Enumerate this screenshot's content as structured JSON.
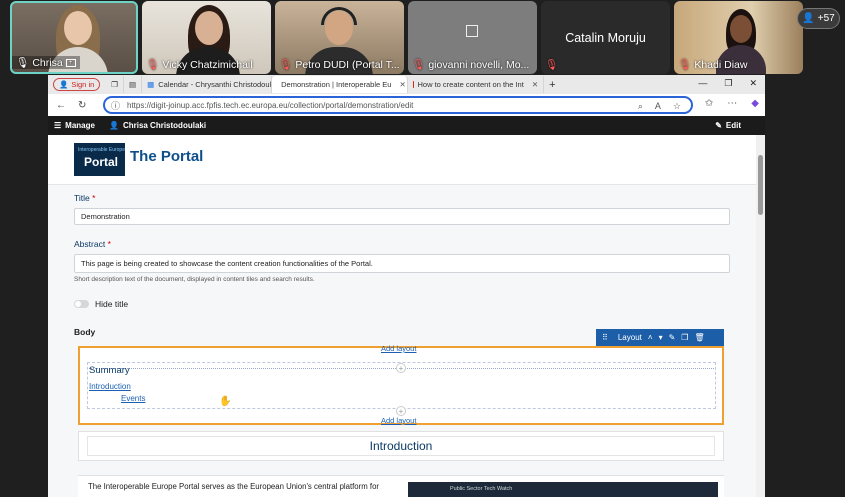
{
  "participants": [
    {
      "name": "Chrisa",
      "speaking": true
    },
    {
      "name": "Vicky Chatzimichail"
    },
    {
      "name": "Petro DUDI (Portal T..."
    },
    {
      "name": "giovanni novelli, Mo..."
    },
    {
      "name": "Catalin Moruju"
    },
    {
      "name": "Khadi Diaw"
    }
  ],
  "overflow_count": "+57",
  "browser": {
    "signin": "Sign in",
    "tabs": [
      {
        "label": "Calendar - Chrysanthi Christodoulaki"
      },
      {
        "label": "Demonstration | Interoperable Eu",
        "active": true
      },
      {
        "label": "How to create content on the Int"
      }
    ],
    "url": "https://digit-joinup.acc.fpfis.tech.ec.europa.eu/collection/portal/demonstration/edit"
  },
  "cms": {
    "manage": "Manage",
    "user": "Chrisa Christodoulaki",
    "edit": "Edit"
  },
  "site": {
    "logo_top": "Interoperable Europe",
    "logo_main": "Portal",
    "name": "The Portal"
  },
  "form": {
    "title_label": "Title",
    "title_value": "Demonstration",
    "abstract_label": "Abstract",
    "abstract_value": "This page is being created to showcase the content creation functionalities of the Portal.",
    "abstract_help": "Short description text of the document, displayed in content tiles and search results.",
    "hide_title": "Hide title",
    "body_label": "Body"
  },
  "layout": {
    "toolbar_label": "Layout",
    "add_layout": "Add layout",
    "summary": "Summary",
    "link_intro": "Introduction",
    "link_events": "Events"
  },
  "section": {
    "heading": "Introduction",
    "paragraph": "The Interoperable Europe Portal serves as the European Union's central platform for",
    "media_caption": "Public Sector Tech Watch"
  }
}
